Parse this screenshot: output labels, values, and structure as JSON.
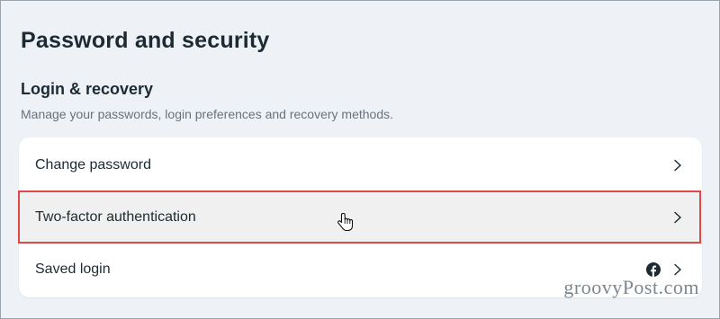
{
  "page": {
    "title": "Password and security"
  },
  "section": {
    "title": "Login & recovery",
    "description": "Manage your passwords, login preferences and recovery methods."
  },
  "items": [
    {
      "label": "Change password",
      "icon": "chevron-right-icon"
    },
    {
      "label": "Two-factor authentication",
      "icon": "chevron-right-icon",
      "highlighted": true
    },
    {
      "label": "Saved login",
      "icons": [
        "facebook-icon",
        "chevron-right-icon"
      ]
    }
  ],
  "watermark": {
    "text": "groovyPost.com"
  },
  "colors": {
    "highlight": "#e04848",
    "background": "#eef2f6",
    "card": "#ffffff"
  }
}
